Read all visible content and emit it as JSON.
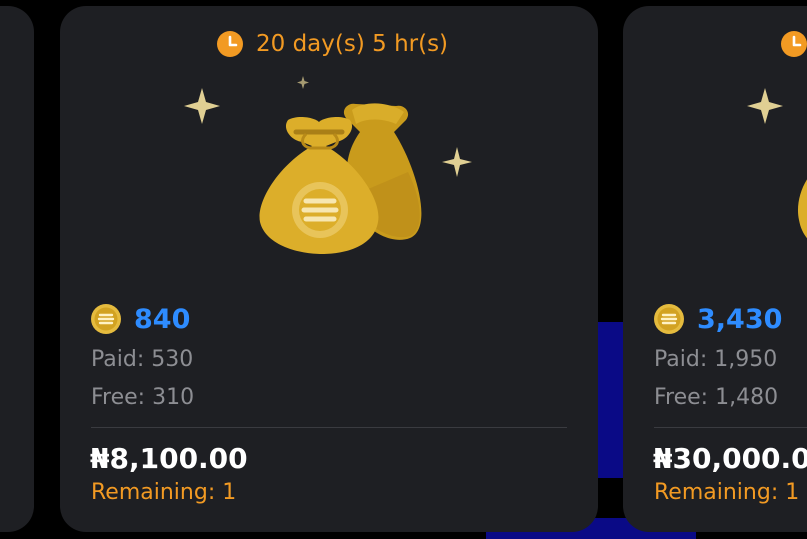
{
  "colors": {
    "accent_orange": "#f29a23",
    "amount_blue": "#2e8cff",
    "card_bg": "#1e1f23",
    "muted_text": "#8d8e93",
    "coin_gold": "#d9ad2a"
  },
  "cards": [
    {
      "timer": "",
      "amount": "",
      "paid": "",
      "free": "",
      "price": "",
      "remaining": ""
    },
    {
      "timer": "20 day(s) 5 hr(s)",
      "timer_icon": "clock-icon",
      "hero_icon": "money-bags-icon",
      "coin_icon": "coin-icon",
      "amount": "840",
      "paid": "Paid: 530",
      "free": "Free: 310",
      "price": "₦8,100.00",
      "remaining": "Remaining: 1"
    },
    {
      "timer": "",
      "timer_icon": "clock-icon",
      "hero_icon": "money-bags-icon",
      "coin_icon": "coin-icon",
      "amount": "3,430",
      "paid": "Paid: 1,950",
      "free": "Free: 1,480",
      "price": "₦30,000.0",
      "remaining": "Remaining: 1"
    }
  ]
}
